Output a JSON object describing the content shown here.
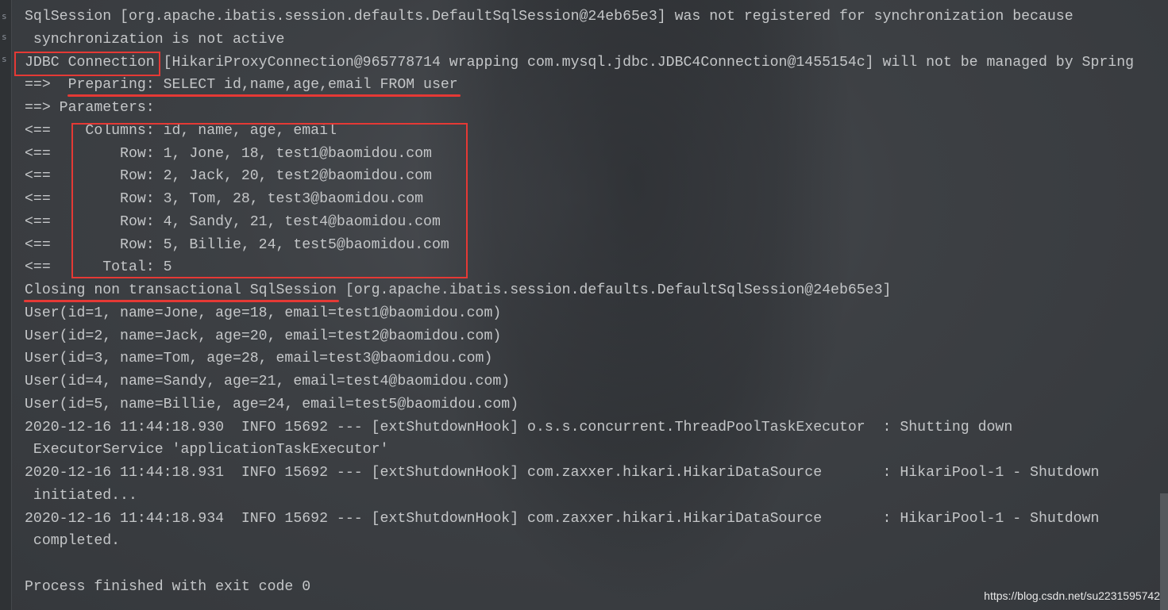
{
  "gutter_labels": [
    "s",
    "s",
    "s"
  ],
  "console_lines": [
    "SqlSession [org.apache.ibatis.session.defaults.DefaultSqlSession@24eb65e3] was not registered for synchronization because",
    " synchronization is not active",
    "JDBC Connection [HikariProxyConnection@965778714 wrapping com.mysql.jdbc.JDBC4Connection@1455154c] will not be managed by Spring",
    "==>  Preparing: SELECT id,name,age,email FROM user",
    "==> Parameters: ",
    "<==    Columns: id, name, age, email",
    "<==        Row: 1, Jone, 18, test1@baomidou.com",
    "<==        Row: 2, Jack, 20, test2@baomidou.com",
    "<==        Row: 3, Tom, 28, test3@baomidou.com",
    "<==        Row: 4, Sandy, 21, test4@baomidou.com",
    "<==        Row: 5, Billie, 24, test5@baomidou.com",
    "<==      Total: 5",
    "Closing non transactional SqlSession [org.apache.ibatis.session.defaults.DefaultSqlSession@24eb65e3]",
    "User(id=1, name=Jone, age=18, email=test1@baomidou.com)",
    "User(id=2, name=Jack, age=20, email=test2@baomidou.com)",
    "User(id=3, name=Tom, age=28, email=test3@baomidou.com)",
    "User(id=4, name=Sandy, age=21, email=test4@baomidou.com)",
    "User(id=5, name=Billie, age=24, email=test5@baomidou.com)",
    "2020-12-16 11:44:18.930  INFO 15692 --- [extShutdownHook] o.s.s.concurrent.ThreadPoolTaskExecutor  : Shutting down",
    " ExecutorService 'applicationTaskExecutor'",
    "2020-12-16 11:44:18.931  INFO 15692 --- [extShutdownHook] com.zaxxer.hikari.HikariDataSource       : HikariPool-1 - Shutdown",
    " initiated...",
    "2020-12-16 11:44:18.934  INFO 15692 --- [extShutdownHook] com.zaxxer.hikari.HikariDataSource       : HikariPool-1 - Shutdown",
    " completed.",
    "",
    "Process finished with exit code 0"
  ],
  "watermark": "https://blog.csdn.net/su2231595742",
  "colors": {
    "text": "#c4c6c8",
    "annotation": "#e53935",
    "background": "#3d4044"
  }
}
